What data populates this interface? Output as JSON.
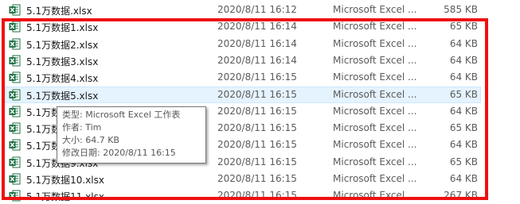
{
  "files": [
    {
      "name": "5.1万数据.xlsx",
      "date": "2020/8/11 16:12",
      "type": "Microsoft Excel ...",
      "size": "585 KB"
    },
    {
      "name": "5.1万数据1.xlsx",
      "date": "2020/8/11 16:14",
      "type": "Microsoft Excel ...",
      "size": "65 KB"
    },
    {
      "name": "5.1万数据2.xlsx",
      "date": "2020/8/11 16:14",
      "type": "Microsoft Excel ...",
      "size": "64 KB"
    },
    {
      "name": "5.1万数据3.xlsx",
      "date": "2020/8/11 16:14",
      "type": "Microsoft Excel ...",
      "size": "64 KB"
    },
    {
      "name": "5.1万数据4.xlsx",
      "date": "2020/8/11 16:15",
      "type": "Microsoft Excel ...",
      "size": "64 KB"
    },
    {
      "name": "5.1万数据5.xlsx",
      "date": "2020/8/11 16:15",
      "type": "Microsoft Excel ...",
      "size": "65 KB"
    },
    {
      "name": "5.1万数据6.xlsx",
      "date": "2020/8/11 16:15",
      "type": "Microsoft Excel ...",
      "size": "64 KB"
    },
    {
      "name": "5.1万数据7.xlsx",
      "date": "2020/8/11 16:15",
      "type": "Microsoft Excel ...",
      "size": "65 KB"
    },
    {
      "name": "5.1万数据8.xlsx",
      "date": "2020/8/11 16:15",
      "type": "Microsoft Excel ...",
      "size": "64 KB"
    },
    {
      "name": "5.1万数据9.xlsx",
      "date": "2020/8/11 16:15",
      "type": "Microsoft Excel ...",
      "size": "65 KB"
    },
    {
      "name": "5.1万数据10.xlsx",
      "date": "2020/8/11 16:15",
      "type": "Microsoft Excel ...",
      "size": "64 KB"
    },
    {
      "name": "5.1万数据11.xlsx",
      "date": "2020/8/11 16:15",
      "type": "Microsoft Excel ...",
      "size": "267 KB"
    }
  ],
  "selected_index": 5,
  "tooltip": {
    "type": "类型: Microsoft Excel 工作表",
    "author": "作者: Tim",
    "size": "大小: 64.7 KB",
    "modified": "修改日期: 2020/8/11 16:15"
  },
  "colors": {
    "highlight_border": "#ee1111",
    "selected_background": "#e5f3ff",
    "excel_green": "#1e7145"
  },
  "icons": {
    "file": "excel-file-icon"
  }
}
